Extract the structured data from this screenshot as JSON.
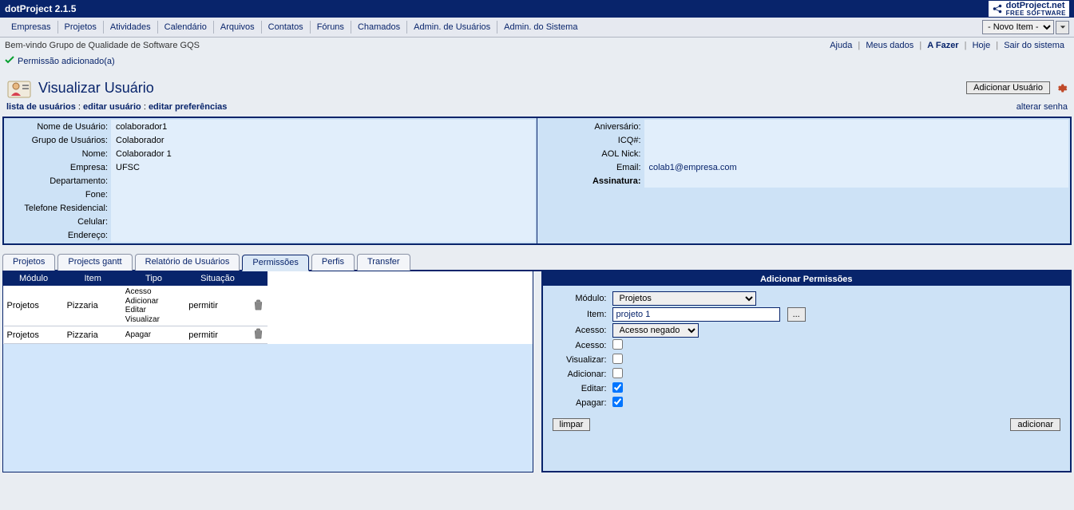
{
  "app_title": "dotProject 2.1.5",
  "logo": {
    "line1": "dotProject.net",
    "line2": "FREE SOFTWARE"
  },
  "nav": {
    "items": [
      "Empresas",
      "Projetos",
      "Atividades",
      "Calendário",
      "Arquivos",
      "Contatos",
      "Fóruns",
      "Chamados",
      "Admin. de Usuários",
      "Admin. do Sistema"
    ],
    "new_item_option": "- Novo Item -"
  },
  "welcome": {
    "text": "Bem-vindo Grupo de Qualidade de Software GQS",
    "links": {
      "help": "Ajuda",
      "mydata": "Meus dados",
      "todo": "A Fazer",
      "today": "Hoje",
      "logout": "Sair do sistema"
    }
  },
  "status_msg": "Permissão adicionado(a)",
  "page": {
    "title": "Visualizar Usuário",
    "add_user_btn": "Adicionar Usuário",
    "subnav": {
      "list": "lista de usuários",
      "edit_user": "editar usuário",
      "edit_prefs": "editar preferências"
    },
    "change_pw": "alterar senha"
  },
  "details": {
    "left": {
      "user_name_label": "Nome de Usuário:",
      "user_name": "colaborador1",
      "user_group_label": "Grupo de Usuários:",
      "user_group": "Colaborador",
      "name_label": "Nome:",
      "name": "Colaborador 1",
      "company_label": "Empresa:",
      "company": "UFSC",
      "dept_label": "Departamento:",
      "dept": "",
      "phone_label": "Fone:",
      "phone": "",
      "home_phone_label": "Telefone Residencial:",
      "home_phone": "",
      "cell_label": "Celular:",
      "cell": "",
      "address_label": "Endereço:",
      "address": ""
    },
    "right": {
      "birthday_label": "Aniversário:",
      "birthday": "",
      "icq_label": "ICQ#:",
      "icq": "",
      "aol_label": "AOL Nick:",
      "aol": "",
      "email_label": "Email:",
      "email": "colab1@empresa.com",
      "sig_label": "Assinatura:",
      "sig": ""
    }
  },
  "tabs": [
    "Projetos",
    "Projects gantt",
    "Relatório de Usuários",
    "Permissões",
    "Perfis",
    "Transfer"
  ],
  "perm_table": {
    "headers": {
      "module": "Módulo",
      "item": "Item",
      "type": "Tipo",
      "status": "Situação",
      "trash": ""
    },
    "rows": [
      {
        "module": "Projetos",
        "item": "Pizzaria",
        "types": [
          "Acesso",
          "Adicionar",
          "Editar",
          "Visualizar"
        ],
        "status": "permitir"
      },
      {
        "module": "Projetos",
        "item": "Pizzaria",
        "types": [
          "Apagar"
        ],
        "status": "permitir"
      }
    ]
  },
  "add_perm": {
    "title": "Adicionar Permissões",
    "labels": {
      "module": "Módulo:",
      "item": "Item:",
      "access": "Acesso:",
      "acesso": "Acesso:",
      "view": "Visualizar:",
      "add": "Adicionar:",
      "edit": "Editar:",
      "del": "Apagar:"
    },
    "values": {
      "module": "Projetos",
      "item": "projeto 1",
      "access": "Acesso negado"
    },
    "ellipsis": "...",
    "buttons": {
      "clear": "limpar",
      "add": "adicionar"
    }
  }
}
